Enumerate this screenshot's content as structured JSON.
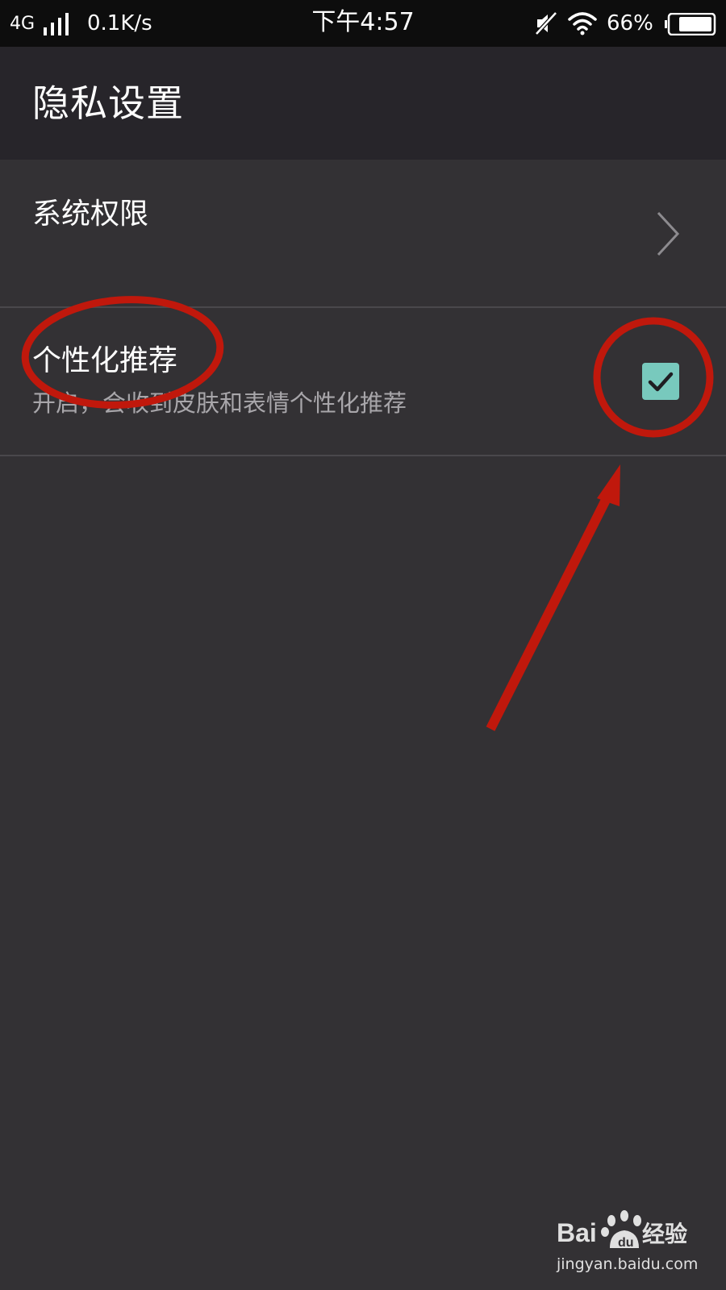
{
  "status_bar": {
    "network": "4G",
    "speed": "0.1K/s",
    "time": "下午4:57",
    "battery_percent": "66%",
    "icons": [
      "signal-icon",
      "mute-icon",
      "wifi-icon",
      "battery-icon"
    ]
  },
  "header": {
    "title": "隐私设置"
  },
  "settings": {
    "items": [
      {
        "title": "系统权限",
        "control": "chevron-right-icon"
      },
      {
        "title": "个性化推荐",
        "subtitle": "开启，会收到皮肤和表情个性化推荐",
        "control": "checkbox",
        "checked": true
      }
    ]
  },
  "colors": {
    "background": "#333134",
    "header_background": "#27252a",
    "status_bar_background": "#0d0d0d",
    "checkbox_accent": "#78c9bd",
    "annotation_red": "#c0180c"
  },
  "watermark": {
    "logo": "Baidu经验",
    "domain": "jingyan.baidu.com"
  }
}
